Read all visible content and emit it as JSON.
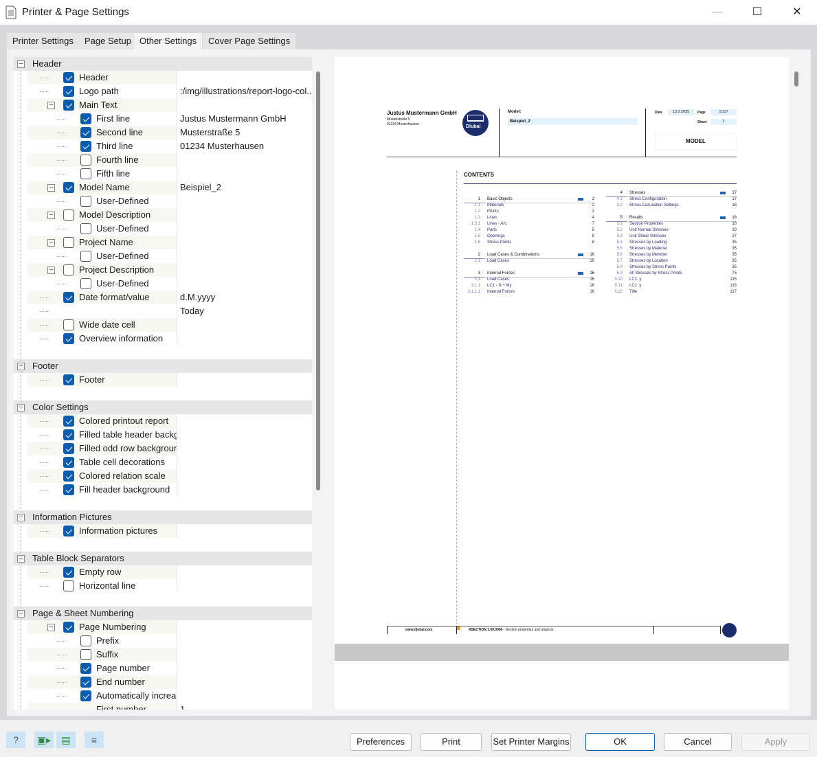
{
  "window": {
    "title": "Printer & Page Settings",
    "minimize": "—",
    "maximize": "☐",
    "close": "✕"
  },
  "tabs": [
    {
      "label": "Printer Settings"
    },
    {
      "label": "Page Setup"
    },
    {
      "label": "Other Settings",
      "active": true
    },
    {
      "label": "Cover Page Settings"
    }
  ],
  "tree": [
    {
      "type": "group",
      "label": "Header"
    },
    {
      "level": 1,
      "label": "Header",
      "checked": true
    },
    {
      "level": 1,
      "label": "Logo path",
      "checked": true,
      "value": ":/img/illustrations/report-logo-col..."
    },
    {
      "level": 1,
      "label": "Main Text",
      "checked": true,
      "toggle": true
    },
    {
      "level": 2,
      "label": "First line",
      "checked": true,
      "value": "Justus Mustermann GmbH"
    },
    {
      "level": 2,
      "label": "Second line",
      "checked": true,
      "value": "Musterstraße 5"
    },
    {
      "level": 2,
      "label": "Third line",
      "checked": true,
      "value": "01234 Musterhausen"
    },
    {
      "level": 2,
      "label": "Fourth line",
      "checked": false
    },
    {
      "level": 2,
      "label": "Fifth line",
      "checked": false
    },
    {
      "level": 1,
      "label": "Model Name",
      "checked": true,
      "toggle": true,
      "value": "Beispiel_2"
    },
    {
      "level": 2,
      "label": "User-Defined",
      "checked": false
    },
    {
      "level": 1,
      "label": "Model Description",
      "checked": false,
      "toggle": true
    },
    {
      "level": 2,
      "label": "User-Defined",
      "checked": false
    },
    {
      "level": 1,
      "label": "Project Name",
      "checked": false,
      "toggle": true
    },
    {
      "level": 2,
      "label": "User-Defined",
      "checked": false
    },
    {
      "level": 1,
      "label": "Project Description",
      "checked": false,
      "toggle": true
    },
    {
      "level": 2,
      "label": "User-Defined",
      "checked": false
    },
    {
      "level": 1,
      "label": "Date format/value",
      "checked": true,
      "value": "d.M.yyyy"
    },
    {
      "level": 1,
      "label": "",
      "value": "Today"
    },
    {
      "level": 1,
      "label": "Wide date cell",
      "checked": false
    },
    {
      "level": 1,
      "label": "Overview information",
      "checked": true
    },
    {
      "type": "blank"
    },
    {
      "type": "group",
      "label": "Footer"
    },
    {
      "level": 1,
      "label": "Footer",
      "checked": true
    },
    {
      "type": "blank"
    },
    {
      "type": "group",
      "label": "Color Settings"
    },
    {
      "level": 1,
      "label": "Colored printout report",
      "checked": true
    },
    {
      "level": 1,
      "label": "Filled table header background",
      "checked": true
    },
    {
      "level": 1,
      "label": "Filled odd row background",
      "checked": true
    },
    {
      "level": 1,
      "label": "Table cell decorations",
      "checked": true
    },
    {
      "level": 1,
      "label": "Colored relation scale",
      "checked": true
    },
    {
      "level": 1,
      "label": "Fill header background",
      "checked": true
    },
    {
      "type": "blank"
    },
    {
      "type": "group",
      "label": "Information Pictures"
    },
    {
      "level": 1,
      "label": "Information pictures",
      "checked": true
    },
    {
      "type": "blank"
    },
    {
      "type": "group",
      "label": "Table Block Separators"
    },
    {
      "level": 1,
      "label": "Empty row",
      "checked": true
    },
    {
      "level": 1,
      "label": "Horizontal line",
      "checked": false
    },
    {
      "type": "blank"
    },
    {
      "type": "group",
      "label": "Page & Sheet Numbering"
    },
    {
      "level": 1,
      "label": "Page Numbering",
      "checked": true,
      "toggle": true
    },
    {
      "level": 2,
      "label": "Prefix",
      "checked": false,
      "value": ""
    },
    {
      "level": 2,
      "label": "Suffix",
      "checked": false
    },
    {
      "level": 2,
      "label": "Page number",
      "checked": true
    },
    {
      "level": 2,
      "label": "End number",
      "checked": true
    },
    {
      "level": 2,
      "label": "Automatically increasing",
      "checked": true
    },
    {
      "level": 2,
      "label": "First number",
      "value": "1"
    }
  ],
  "preview": {
    "company": "Justus Mustermann GmbH",
    "street": "Musterstraße 5",
    "city": "01234 Musterhausen",
    "logo_text": "Dlubal",
    "model_label": "Model:",
    "model_value": "Beispiel_2",
    "date_label": "Date",
    "date_value": "13.2.2025",
    "page_label": "Page",
    "page_value": "1/117",
    "sheet_label": "Sheet",
    "sheet_value": "1",
    "section_title": "MODEL",
    "contents_title": "CONTENTS",
    "toc_left": [
      {
        "n": "1",
        "t": "Basic Objects",
        "p": "2",
        "h": true
      },
      {
        "n": "1.1",
        "t": "Materials",
        "p": "2"
      },
      {
        "n": "1.2",
        "t": "Points",
        "p": "2"
      },
      {
        "n": "1.3",
        "t": "Lines",
        "p": "4"
      },
      {
        "n": "1.3.1",
        "t": "Lines - Arc",
        "p": "7"
      },
      {
        "n": "1.4",
        "t": "Parts",
        "p": "8"
      },
      {
        "n": "1.5",
        "t": "Openings",
        "p": "8"
      },
      {
        "n": "1.6",
        "t": "Stress Points",
        "p": "8"
      },
      {
        "gap": true
      },
      {
        "n": "2",
        "t": "Load Cases & Combinations",
        "p": "16",
        "h": true
      },
      {
        "n": "2.1",
        "t": "Load Cases",
        "p": "16"
      },
      {
        "gap": true
      },
      {
        "n": "3",
        "t": "Internal Forces",
        "p": "16",
        "h": true
      },
      {
        "n": "3.1",
        "t": "Load Cases",
        "p": "16"
      },
      {
        "n": "3.1.1",
        "t": "LC1 - N + My",
        "p": "16"
      },
      {
        "n": "3.1.1.1",
        "t": "Internal Forces",
        "p": "16"
      }
    ],
    "toc_right": [
      {
        "n": "4",
        "t": "Stresses",
        "p": "17",
        "h": true
      },
      {
        "n": "4.1",
        "t": "Stress Configuration",
        "p": "17"
      },
      {
        "n": "4.2",
        "t": "Stress Calculation Settings",
        "p": "18"
      },
      {
        "gap": true
      },
      {
        "n": "5",
        "t": "Results",
        "p": "18",
        "h": true
      },
      {
        "n": "5.1",
        "t": "Section Properties",
        "p": "18"
      },
      {
        "n": "5.2",
        "t": "Unit Normal Stresses",
        "p": "19"
      },
      {
        "n": "5.3",
        "t": "Unit Shear Stresses",
        "p": "27"
      },
      {
        "n": "5.4",
        "t": "Stresses by Loading",
        "p": "35"
      },
      {
        "n": "5.5",
        "t": "Stresses by Material",
        "p": "35"
      },
      {
        "n": "5.6",
        "t": "Stresses by Member",
        "p": "35"
      },
      {
        "n": "5.7",
        "t": "Stresses by Location",
        "p": "35"
      },
      {
        "n": "5.8",
        "t": "Stresses by Stress Points",
        "p": "35"
      },
      {
        "n": "5.9",
        "t": "All Stresses by Stress Points",
        "p": "75"
      },
      {
        "n": "5.10",
        "t": "LC1: y",
        "p": "115"
      },
      {
        "n": "5.11",
        "t": "LC1: y",
        "p": "116"
      },
      {
        "n": "5.12",
        "t": "Title",
        "p": "117"
      }
    ],
    "footer_url": "www.dlubal.com",
    "footer_product": "RSECTION 1.09.0004",
    "footer_desc": " - Section properties and analysis"
  },
  "toolbar_icons": [
    "help-icon",
    "load-settings-icon",
    "save-settings-icon",
    "database-report-icon"
  ],
  "buttons": {
    "preferences": "Preferences",
    "print": "Print",
    "margins": "Set Printer Margins",
    "ok": "OK",
    "cancel": "Cancel",
    "apply": "Apply"
  },
  "colors": {
    "accent": "#0b5cad",
    "logo": "#1c2d6e",
    "highlight": "#e3f2fc"
  }
}
